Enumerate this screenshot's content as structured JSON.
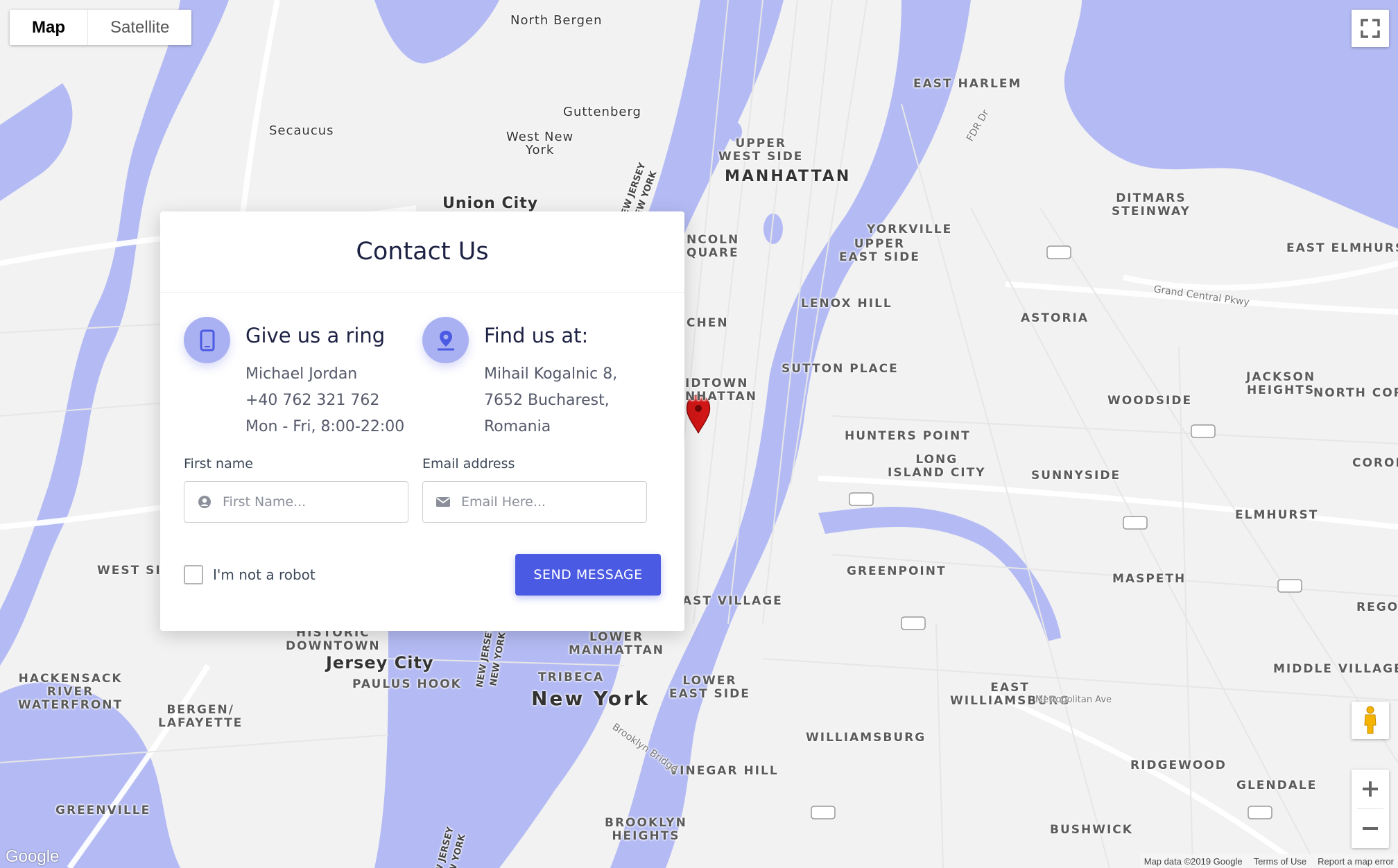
{
  "map": {
    "type_control": {
      "map_label": "Map",
      "satellite_label": "Satellite",
      "selected": "Map"
    },
    "labels": {
      "north_bergen": "North Bergen",
      "guttenberg": "Guttenberg",
      "secaucus": "Secaucus",
      "west_new_york": "West New\nYork",
      "union_city": "Union City",
      "manhattan": "MANHATTAN",
      "upper_west_side": "UPPER\nWEST SIDE",
      "east_harlem": "EAST HARLEM",
      "yorkville": "YORKVILLE",
      "upper_east_side": "UPPER\nEAST SIDE",
      "lincoln_square": "NCOLN\nQUARE",
      "lenox_hill": "LENOX HILL",
      "kitchen": "CHEN",
      "midtown": "IDTOWN\nNHATTAN",
      "sutton_place": "SUTTON PLACE",
      "astoria": "ASTORIA",
      "ditmars": "DITMARS\nSTEINWAY",
      "east_elmhurst": "EAST ELMHURST",
      "jackson_heights": "JACKSON\nHEIGHTS",
      "north_corona": "NORTH CORO",
      "woodside": "WOODSIDE",
      "hunters_point": "HUNTERS POINT",
      "long_island_city": "LONG\nISLAND CITY",
      "sunnyside": "SUNNYSIDE",
      "corona": "CORON",
      "elmhurst": "ELMHURST",
      "greenpoint": "GREENPOINT",
      "maspeth": "MASPETH",
      "rego": "REGO",
      "east_village": "AST VILLAGE",
      "west_side": "WEST SID",
      "historic_downtown": "HISTORIC\nDOWNTOWN",
      "jersey_city": "Jersey City",
      "paulus_hook": "PAULUS HOOK",
      "lower_manhattan": "LOWER\nMANHATTAN",
      "tribeca": "TRIBECA",
      "lower_east_side": "LOWER\nEAST SIDE",
      "new_york": "New York",
      "hackensack": "HACKENSACK\nRIVER\nWATERFRONT",
      "bergen_lafayette": "BERGEN/\nLAFAYETTE",
      "east_williamsburg": "EAST\nWILLIAMSBURG",
      "williamsburg": "WILLIAMSBURG",
      "middle_village": "MIDDLE VILLAGE",
      "ridgewood": "RIDGEWOOD",
      "glendale": "GLENDALE",
      "vinegar_hill": "VINEGAR HILL",
      "greenville": "GREENVILLE",
      "brooklyn_heights": "BROOKLYN\nHEIGHTS",
      "bushwick": "BUSHWICK",
      "grand_central_pkwy": "Grand Central Pkwy",
      "new_jersey_1": "NEW JERSEY\nNEW YORK",
      "new_jersey_2": "NEW JERSEY\nNEW YORK",
      "new_jersey_3": "NEW JERSEY\nNEW YORK",
      "fdr_dr": "FDR Dr",
      "brooklyn_bridge": "Brooklyn Bridge",
      "metropolitan_ave": "Metropolitan Ave"
    },
    "attribution": {
      "data": "Map data ©2019 Google",
      "terms": "Terms of Use",
      "report": "Report a map error"
    },
    "logo": "Google",
    "colors": {
      "water": "#b4bbf4",
      "land": "#f2f2f2",
      "road": "#ffffff",
      "marker": "#d01616"
    }
  },
  "contact": {
    "title": "Contact Us",
    "phone": {
      "icon": "phone-icon",
      "title": "Give us a ring",
      "name": "Michael Jordan",
      "number": "+40 762 321 762",
      "hours": "Mon - Fri, 8:00-22:00"
    },
    "location": {
      "icon": "location-pin-icon",
      "title": "Find us at:",
      "line1": "Mihail Kogalnic 8,",
      "line2": "7652 Bucharest,",
      "line3": "Romania"
    },
    "form": {
      "first_name_label": "First name",
      "first_name_placeholder": "First Name...",
      "first_name_value": "",
      "email_label": "Email address",
      "email_placeholder": "Email Here...",
      "email_value": "",
      "robot_label": "I'm not a robot",
      "robot_checked": false,
      "send_label": "SEND MESSAGE"
    },
    "colors": {
      "accent": "#4b5ae3",
      "icon_bg": "#aab1f2",
      "title": "#1d2244"
    }
  }
}
